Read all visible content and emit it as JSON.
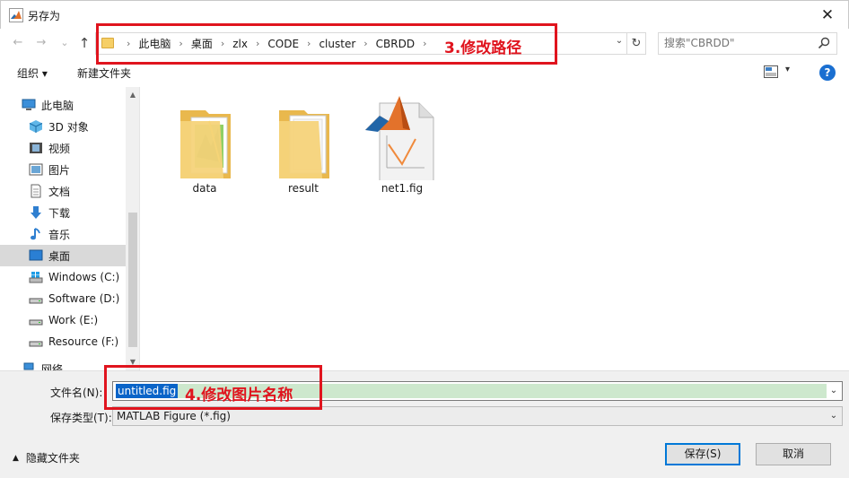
{
  "window": {
    "title": "另存为",
    "close_glyph": "✕"
  },
  "nav_buttons": {
    "back": "←",
    "forward": "→",
    "recent": "⌄",
    "up": "↑"
  },
  "address": {
    "crumbs": [
      "此电脑",
      "桌面",
      "zlx",
      "CODE",
      "cluster",
      "CBRDD"
    ],
    "separator": "›",
    "dropdown_glyph": "⌄",
    "refresh_glyph": "↻"
  },
  "search": {
    "placeholder": "搜索\"CBRDD\""
  },
  "toolbar": {
    "organize_label": "组织 ▾",
    "new_folder_label": "新建文件夹",
    "help_glyph": "?",
    "view_dd": "▾"
  },
  "sidebar": {
    "items": [
      {
        "label": "此电脑",
        "icon": "pc-icon"
      },
      {
        "label": "3D 对象",
        "icon": "cube-icon"
      },
      {
        "label": "视频",
        "icon": "video-icon"
      },
      {
        "label": "图片",
        "icon": "picture-icon"
      },
      {
        "label": "文档",
        "icon": "document-icon"
      },
      {
        "label": "下载",
        "icon": "download-icon"
      },
      {
        "label": "音乐",
        "icon": "music-icon"
      },
      {
        "label": "桌面",
        "icon": "desktop-icon",
        "selected": true
      },
      {
        "label": "Windows (C:)",
        "icon": "windows-drive-icon"
      },
      {
        "label": "Software (D:)",
        "icon": "drive-icon"
      },
      {
        "label": "Work (E:)",
        "icon": "drive-icon"
      },
      {
        "label": "Resource (F:)",
        "icon": "drive-icon"
      },
      {
        "label": "网络",
        "icon": "network-icon"
      }
    ],
    "scroll_up": "▲",
    "scroll_down": "▼"
  },
  "files": [
    {
      "name": "data",
      "type": "folder",
      "icon": "folder-with-images-icon"
    },
    {
      "name": "result",
      "type": "folder",
      "icon": "folder-with-pages-icon"
    },
    {
      "name": "net1.fig",
      "type": "file",
      "icon": "matlab-figure-icon"
    }
  ],
  "filename": {
    "label": "文件名(N):",
    "value": "untitled.fig",
    "dropdown_glyph": "⌄"
  },
  "filetype": {
    "label": "保存类型(T):",
    "value": "MATLAB Figure (*.fig)",
    "dropdown_glyph": "⌄"
  },
  "hide_folders": {
    "label": "隐藏文件夹",
    "chevron": "▲"
  },
  "buttons": {
    "save": "保存(S)",
    "cancel": "取消"
  },
  "annotations": {
    "path_note": "3.修改路径",
    "name_note": "4.修改图片名称"
  },
  "colors": {
    "annotation_red": "#e0141e",
    "selection_blue": "#0a64c8",
    "accent": "#0078d7"
  }
}
